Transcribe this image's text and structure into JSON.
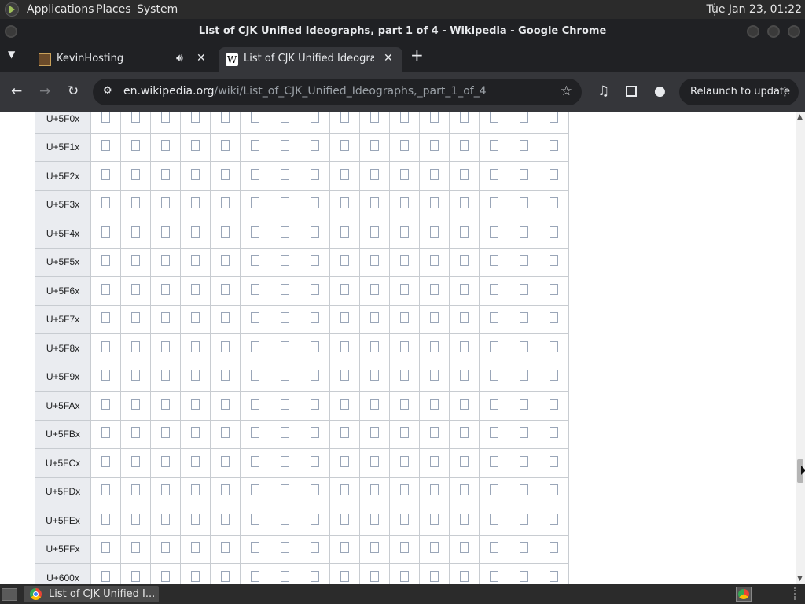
{
  "panel": {
    "menus": [
      "Applications",
      "Places",
      "System"
    ],
    "clock": "Tue Jan 23, 01:22"
  },
  "window": {
    "title": "List of CJK Unified Ideographs, part 1 of 4 - Wikipedia - Google Chrome"
  },
  "tabs": [
    {
      "title": "KevinHosting",
      "audio_icon": "speaker-icon"
    },
    {
      "title": "List of CJK Unified Ideograph",
      "favicon": "W"
    }
  ],
  "toolbar": {
    "url_host": "en.wikipedia.org",
    "url_path": "/wiki/List_of_CJK_Unified_Ideographs,_part_1_of_4",
    "relaunch_label": "Relaunch to update"
  },
  "table": {
    "rows": [
      "U+5F0x",
      "U+5F1x",
      "U+5F2x",
      "U+5F3x",
      "U+5F4x",
      "U+5F5x",
      "U+5F6x",
      "U+5F7x",
      "U+5F8x",
      "U+5F9x",
      "U+5FAx",
      "U+5FBx",
      "U+5FCx",
      "U+5FDx",
      "U+5FEx",
      "U+5FFx",
      "U+600x"
    ],
    "cells_per_row": 16,
    "glyph": "□"
  },
  "taskbar": {
    "task_label": "List of CJK Unified I..."
  },
  "colors": {
    "panel_bg": "#2b2b2b",
    "chrome_dark": "#202124",
    "chrome_toolbar": "#35363a",
    "table_border": "#c8ccd1",
    "row_header_bg": "#eaecf0"
  }
}
